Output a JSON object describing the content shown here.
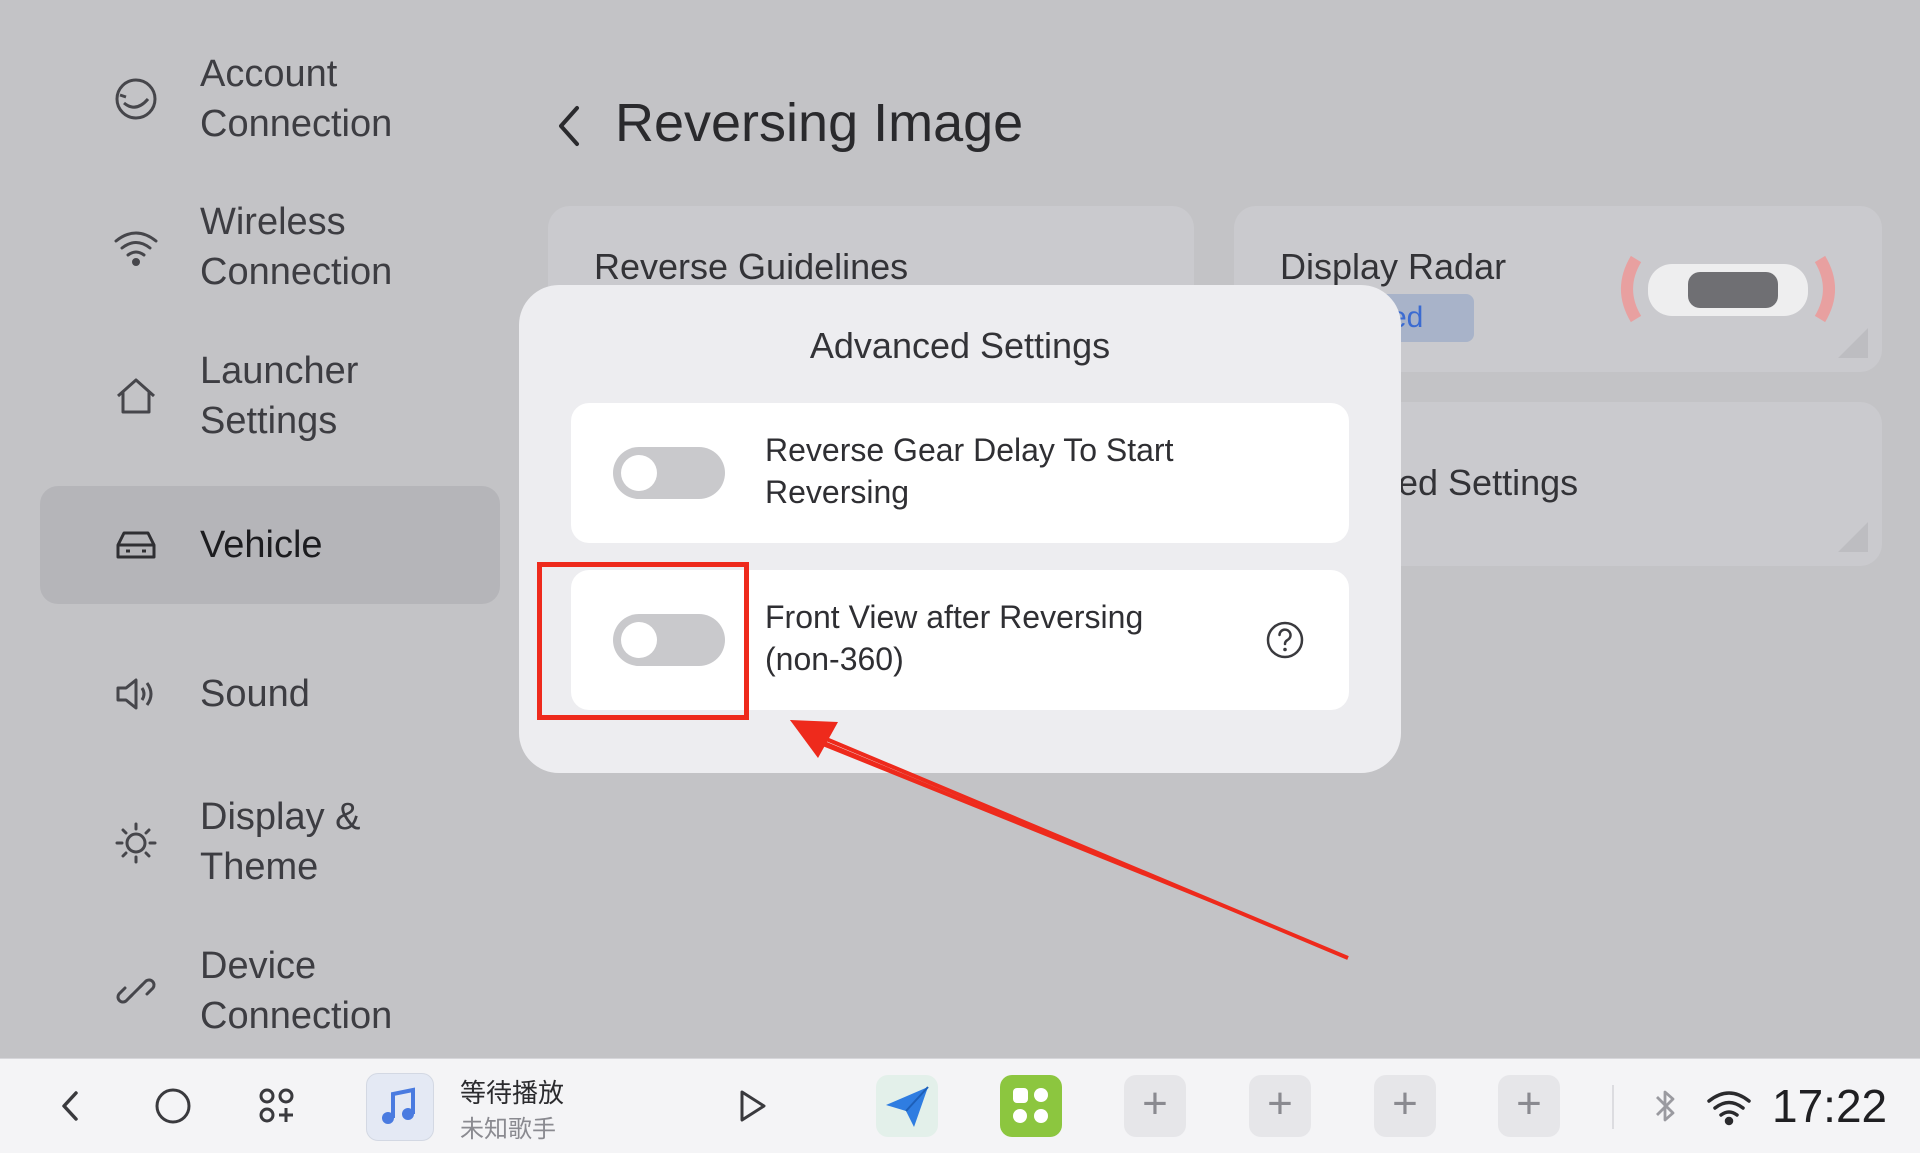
{
  "sidebar": {
    "items": [
      {
        "label": "Account\nConnection",
        "icon": "account-icon"
      },
      {
        "label": "Wireless\nConnection",
        "icon": "wifi-icon"
      },
      {
        "label": "Launcher\nSettings",
        "icon": "home-icon"
      },
      {
        "label": "Vehicle",
        "icon": "car-icon",
        "active": true
      },
      {
        "label": "Sound",
        "icon": "speaker-icon"
      },
      {
        "label": "Display &\nTheme",
        "icon": "brightness-icon"
      },
      {
        "label": "Device\nConnection",
        "icon": "link-icon"
      }
    ]
  },
  "header": {
    "title": "Reversing Image",
    "back_icon": "chevron-left-icon"
  },
  "cards": {
    "reverse_guidelines": "Reverse Guidelines",
    "display_radar": "Display Radar",
    "display_radar_badge": "ed",
    "advanced_partial": "ed Settings"
  },
  "modal": {
    "title": "Advanced Settings",
    "options": [
      {
        "label": "Reverse Gear Delay To Start\nReversing",
        "enabled": false
      },
      {
        "label": "Front View after Reversing\n(non-360)",
        "enabled": false,
        "help_icon": "question-circle-icon"
      }
    ]
  },
  "annotation": {
    "color": "#ee2a1c"
  },
  "taskbar": {
    "music_title": "等待播放",
    "music_artist": "未知歌手",
    "plus_label": "+",
    "clock": "17:22"
  },
  "colors": {
    "accent_blue": "#3b6bd1",
    "app_green": "#8cc63f",
    "highlight": "#ee2a1c"
  }
}
